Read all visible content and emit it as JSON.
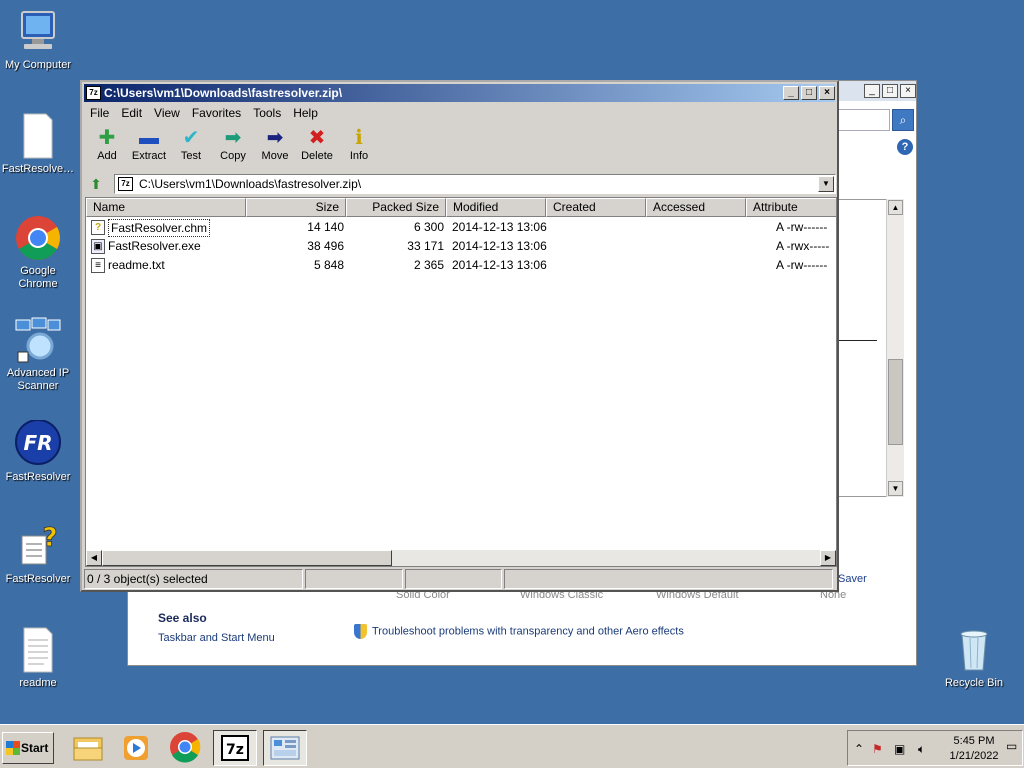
{
  "desktop": {
    "icons": [
      {
        "label": "My Computer"
      },
      {
        "label": "FastResolve…"
      },
      {
        "label": "Google Chrome"
      },
      {
        "label": "Advanced IP Scanner"
      },
      {
        "label": "FastResolver"
      },
      {
        "label": "FastResolver"
      },
      {
        "label": "readme"
      },
      {
        "label": "Recycle Bin"
      }
    ]
  },
  "background_window": {
    "saver_label": "Saver",
    "themes": [
      "Solid Color",
      "Windows Classic",
      "Windows Default",
      "None"
    ],
    "see_also": "See also",
    "taskbar_link": "Taskbar and Start Menu",
    "troubleshoot": "Troubleshoot problems with transparency and other Aero effects",
    "search_icon": "search-icon",
    "help_icon": "help-icon",
    "help_text": "?"
  },
  "zip": {
    "app_icon_text": "7z",
    "title": "C:\\Users\\vm1\\Downloads\\fastresolver.zip\\",
    "menu": [
      "File",
      "Edit",
      "View",
      "Favorites",
      "Tools",
      "Help"
    ],
    "toolbar": [
      {
        "label": "Add",
        "icon": "plus-icon",
        "color": "#2ea043"
      },
      {
        "label": "Extract",
        "icon": "minus-icon",
        "color": "#1f4fbf"
      },
      {
        "label": "Test",
        "icon": "check-icon",
        "color": "#2bb6c9"
      },
      {
        "label": "Copy",
        "icon": "copy-arrow-icon",
        "color": "#1e9c7a"
      },
      {
        "label": "Move",
        "icon": "move-arrow-icon",
        "color": "#1a237e"
      },
      {
        "label": "Delete",
        "icon": "delete-x-icon",
        "color": "#d21f1f"
      },
      {
        "label": "Info",
        "icon": "info-icon",
        "color": "#c9a400"
      }
    ],
    "address": "C:\\Users\\vm1\\Downloads\\fastresolver.zip\\",
    "columns": [
      "Name",
      "Size",
      "Packed Size",
      "Modified",
      "Created",
      "Accessed",
      "Attribute"
    ],
    "files": [
      {
        "name": "FastResolver.chm",
        "size": "14 140",
        "packed": "6 300",
        "modified": "2014-12-13 13:06",
        "attr": "A -rw------"
      },
      {
        "name": "FastResolver.exe",
        "size": "38 496",
        "packed": "33 171",
        "modified": "2014-12-13 13:06",
        "attr": "A -rwx-----"
      },
      {
        "name": "readme.txt",
        "size": "5 848",
        "packed": "2 365",
        "modified": "2014-12-13 13:06",
        "attr": "A -rw------"
      }
    ],
    "status": "0 / 3 object(s) selected"
  },
  "taskbar": {
    "start_label": "Start",
    "time": "5:45 PM",
    "date": "1/21/2022",
    "pinned": [
      "file-explorer-icon",
      "media-player-icon",
      "chrome-icon",
      "7zip-icon",
      "network-scanner-icon"
    ],
    "seven_zip_text": "7z"
  },
  "colors": {
    "desktop": "#3d6ea6",
    "title_active": "#0a246a",
    "window_face": "#d6d3ce"
  }
}
